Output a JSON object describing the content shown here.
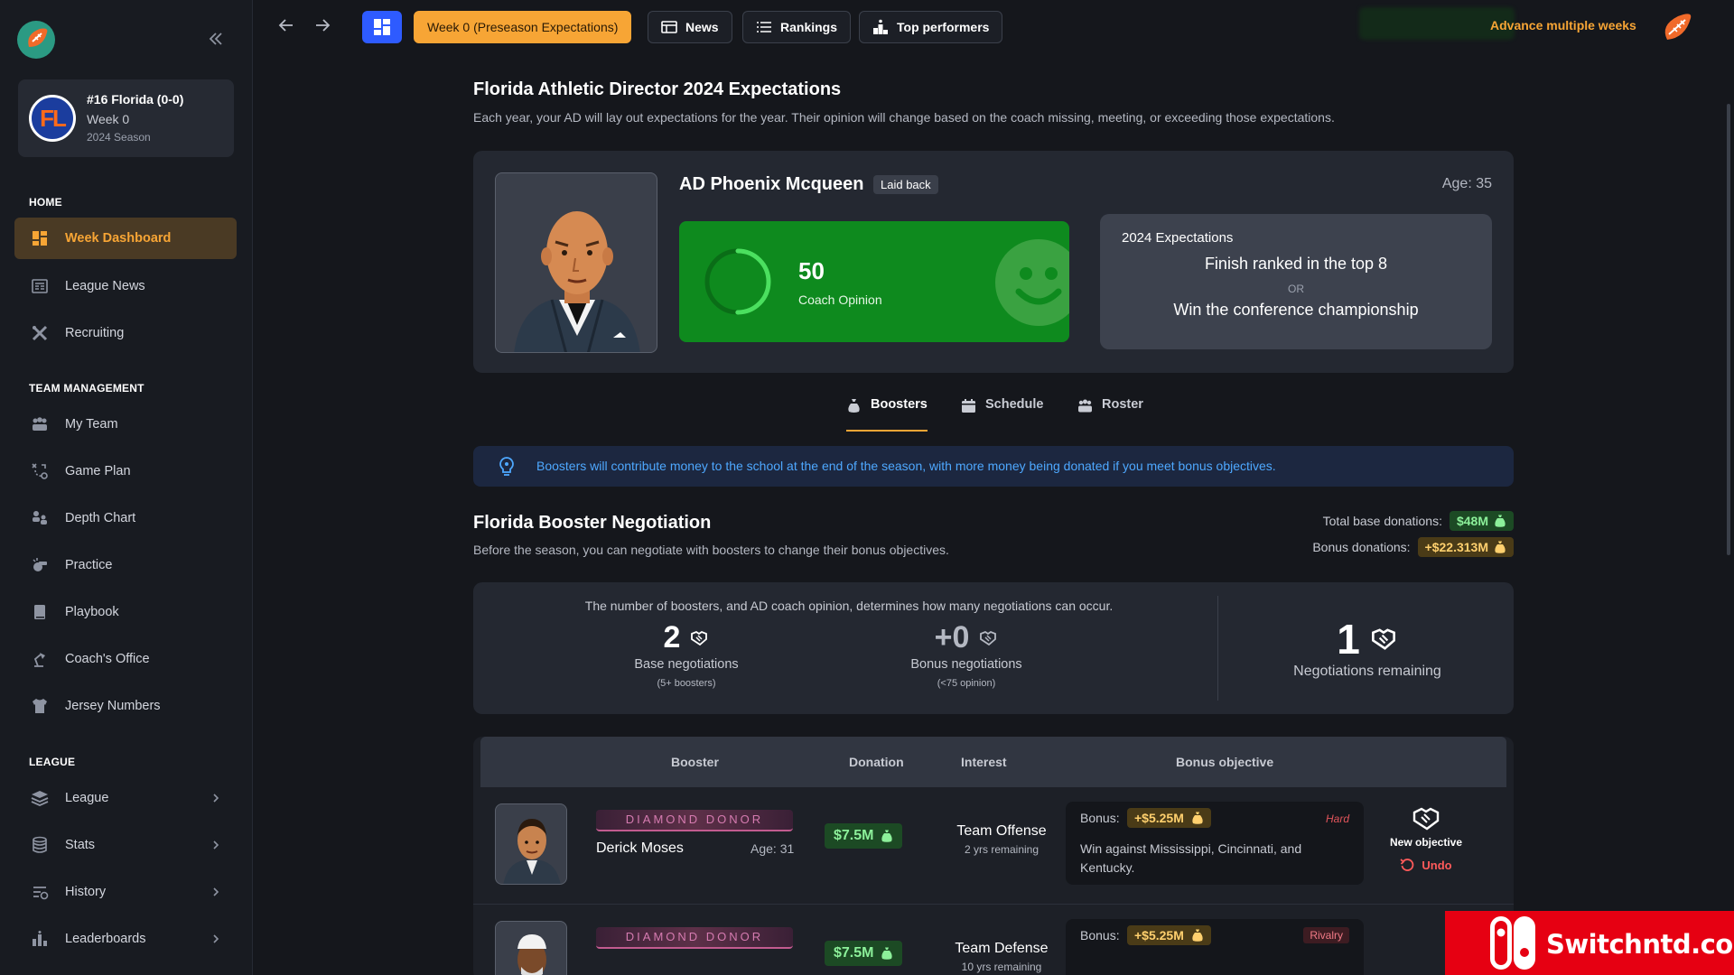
{
  "sidebar": {
    "team": {
      "logo_text": "FL",
      "name": "#16 Florida (0-0)",
      "week": "Week 0",
      "season": "2024 Season"
    },
    "sections": {
      "home": "HOME",
      "team_management": "TEAM MANAGEMENT",
      "league": "LEAGUE"
    },
    "items": [
      {
        "label": "Week Dashboard",
        "icon": "dashboard-icon",
        "active": true
      },
      {
        "label": "League News",
        "icon": "newspaper-icon"
      },
      {
        "label": "Recruiting",
        "icon": "recruiting-icon"
      },
      {
        "label": "My Team",
        "icon": "team-icon"
      },
      {
        "label": "Game Plan",
        "icon": "game-plan-icon"
      },
      {
        "label": "Depth Chart",
        "icon": "depth-chart-icon"
      },
      {
        "label": "Practice",
        "icon": "whistle-icon"
      },
      {
        "label": "Playbook",
        "icon": "playbook-icon"
      },
      {
        "label": "Coach's Office",
        "icon": "desk-lamp-icon"
      },
      {
        "label": "Jersey Numbers",
        "icon": "jersey-icon"
      },
      {
        "label": "League",
        "icon": "layers-icon",
        "expandable": true
      },
      {
        "label": "Stats",
        "icon": "database-icon",
        "expandable": true
      },
      {
        "label": "History",
        "icon": "history-icon",
        "expandable": true
      },
      {
        "label": "Leaderboards",
        "icon": "leaderboard-icon",
        "expandable": true
      }
    ]
  },
  "topbar": {
    "week_button": "Week 0 (Preseason Expectations)",
    "news": "News",
    "rankings": "Rankings",
    "top_performers": "Top performers",
    "advance": "Advance multiple weeks"
  },
  "header": {
    "title": "Florida Athletic Director 2024 Expectations",
    "subtitle": "Each year, your AD will lay out expectations for the year. Their opinion will change based on the coach missing, meeting, or exceeding those expectations."
  },
  "ad": {
    "name": "AD Phoenix Mcqueen",
    "badge": "Laid back",
    "age": "Age: 35",
    "opinion_value": "50",
    "opinion_label": "Coach Opinion",
    "opinion_fraction": 0.5,
    "expectations_title": "2024 Expectations",
    "expectation_1": "Finish ranked in the top 8",
    "or": "OR",
    "expectation_2": "Win the conference championship"
  },
  "tabs": [
    {
      "label": "Boosters",
      "icon": "money-bag-icon",
      "active": true
    },
    {
      "label": "Schedule",
      "icon": "calendar-icon"
    },
    {
      "label": "Roster",
      "icon": "roster-icon"
    }
  ],
  "info_text": "Boosters will contribute money to the school at the end of the season, with more money being donated if you meet bonus objectives.",
  "negotiation": {
    "title": "Florida Booster Negotiation",
    "subtitle": "Before the season, you can negotiate with boosters to change their bonus objectives.",
    "total_base_label": "Total base donations:",
    "total_base_value": "$48M",
    "bonus_label": "Bonus donations:",
    "bonus_value": "+$22.313M",
    "explain": "The number of boosters, and AD coach opinion, determines how many negotiations can occur.",
    "base_value": "2",
    "base_label": "Base negotiations",
    "base_sub": "(5+ boosters)",
    "bonus_neg_value": "+0",
    "bonus_neg_label": "Bonus negotiations",
    "bonus_neg_sub": "(<75 opinion)",
    "remaining_value": "1",
    "remaining_label": "Negotiations remaining"
  },
  "table": {
    "headers": {
      "booster": "Booster",
      "donation": "Donation",
      "interest": "Interest",
      "bonus_objective": "Bonus objective"
    },
    "rows": [
      {
        "tier": "DIAMOND DONOR",
        "name": "Derick Moses",
        "age": "Age: 31",
        "donation": "$7.5M",
        "interest": "Team Offense",
        "remaining": "2 yrs remaining",
        "bonus_label": "Bonus:",
        "bonus": "+$5.25M",
        "difficulty": "Hard",
        "objective": "Win against Mississippi, Cincinnati, and Kentucky.",
        "action": "New objective",
        "undo": "Undo"
      },
      {
        "tier": "DIAMOND DONOR",
        "name": "",
        "age": "",
        "donation": "$7.5M",
        "interest": "Team Defense",
        "remaining": "10 yrs remaining",
        "bonus_label": "Bonus:",
        "bonus": "+$5.25M",
        "difficulty": "Rivalry",
        "objective": "",
        "action": "",
        "undo": ""
      }
    ]
  },
  "watermark": "Switchntd.com",
  "colors": {
    "accent": "#f7a535",
    "primary": "#2e5bff",
    "opinion_green": "#0e8a1e",
    "info_blue": "#4ea8ff",
    "danger": "#ff5a5a"
  }
}
